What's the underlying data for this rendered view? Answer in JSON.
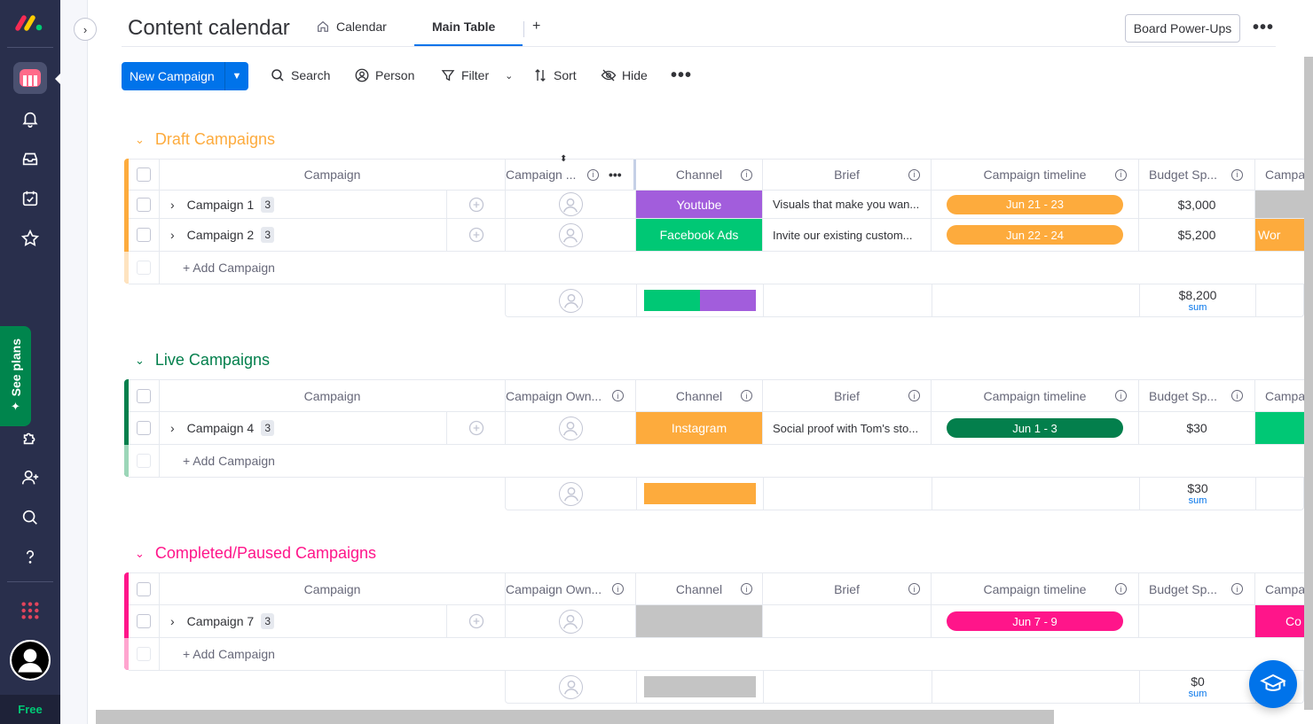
{
  "app": {
    "plan_label": "Free",
    "see_plans_label": "See plans"
  },
  "board": {
    "title": "Content calendar",
    "tabs": [
      {
        "label": "Calendar"
      },
      {
        "label": "Main Table"
      }
    ],
    "add_tab_label": "+",
    "powerups_label": "Board Power-Ups"
  },
  "toolbar": {
    "new_label": "New Campaign",
    "search_label": "Search",
    "person_label": "Person",
    "filter_label": "Filter",
    "sort_label": "Sort",
    "hide_label": "Hide"
  },
  "columns": {
    "item": "Campaign",
    "owner_short": "Campaign ...",
    "owner": "Campaign Own...",
    "channel": "Channel",
    "brief": "Brief",
    "timeline": "Campaign timeline",
    "budget": "Budget Sp...",
    "last": "Campa"
  },
  "add_item_label": "+ Add Campaign",
  "sum_label": "sum",
  "colors": {
    "draft": "#fdab3d",
    "live": "#037f4c",
    "completed": "#ff158a",
    "youtube": "#a25ddc",
    "facebook": "#00c875",
    "instagram": "#fdab3d",
    "empty": "#c4c4c4",
    "accent": "#0073ea"
  },
  "groups": [
    {
      "title": "Draft Campaigns",
      "items": [
        {
          "name": "Campaign 1",
          "subitems": "3",
          "channel": "Youtube",
          "brief": "Visuals that make you wan...",
          "timeline": "Jun 21 - 23",
          "budget": "$3,000",
          "last": ""
        },
        {
          "name": "Campaign 2",
          "subitems": "3",
          "channel": "Facebook Ads",
          "brief": "Invite our existing custom...",
          "timeline": "Jun 22 - 24",
          "budget": "$5,200",
          "last": "Wor"
        }
      ],
      "sum": "$8,200"
    },
    {
      "title": "Live Campaigns",
      "items": [
        {
          "name": "Campaign 4",
          "subitems": "3",
          "channel": "Instagram",
          "brief": "Social proof with Tom's sto...",
          "timeline": "Jun 1 - 3",
          "budget": "$30",
          "last": ""
        }
      ],
      "sum": "$30"
    },
    {
      "title": "Completed/Paused Campaigns",
      "items": [
        {
          "name": "Campaign 7",
          "subitems": "3",
          "channel": "",
          "brief": "",
          "timeline": "Jun 7 - 9",
          "budget": "",
          "last": "Co"
        }
      ],
      "sum": "$0"
    }
  ]
}
